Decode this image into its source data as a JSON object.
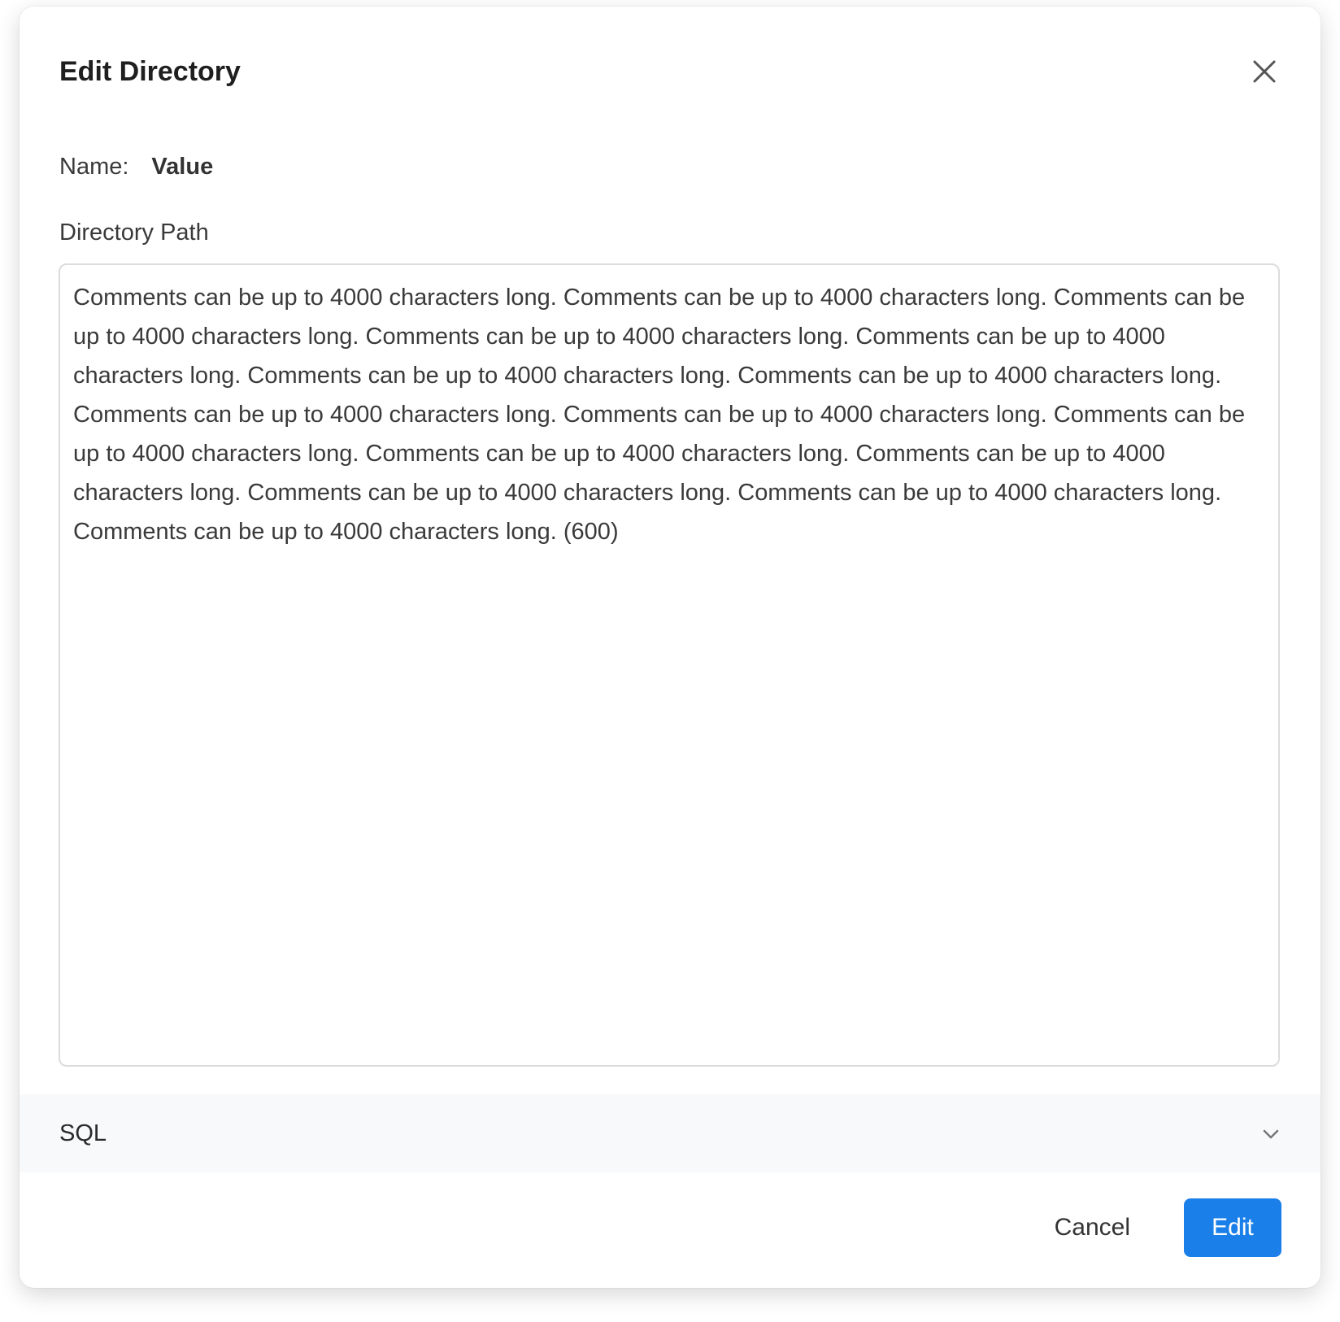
{
  "dialog": {
    "title": "Edit Directory",
    "close_icon": "close-icon"
  },
  "name_field": {
    "label": "Name:",
    "value": "Value"
  },
  "directory_path": {
    "label": "Directory Path",
    "value": "Comments can be up to 4000 characters long. Comments can be up to 4000 characters long. Comments can be up to 4000 characters long. Comments can be up to 4000 characters long. Comments can be up to 4000 characters long. Comments can be up to 4000 characters long. Comments can be up to 4000 characters long. Comments can be up to 4000 characters long. Comments can be up to 4000 characters long. Comments can be up to 4000 characters long. Comments can be up to 4000 characters long. Comments can be up to 4000 characters long. Comments can be up to 4000 characters long. Comments can be up to 4000 characters long. Comments can be up to 4000 characters long. (600)"
  },
  "sql_section": {
    "label": "SQL",
    "expand_icon": "chevron-down-icon"
  },
  "footer": {
    "cancel_label": "Cancel",
    "edit_label": "Edit"
  },
  "colors": {
    "primary": "#1a7fe8",
    "section_bg": "#f8f9fa",
    "border": "#dcdcdc"
  }
}
